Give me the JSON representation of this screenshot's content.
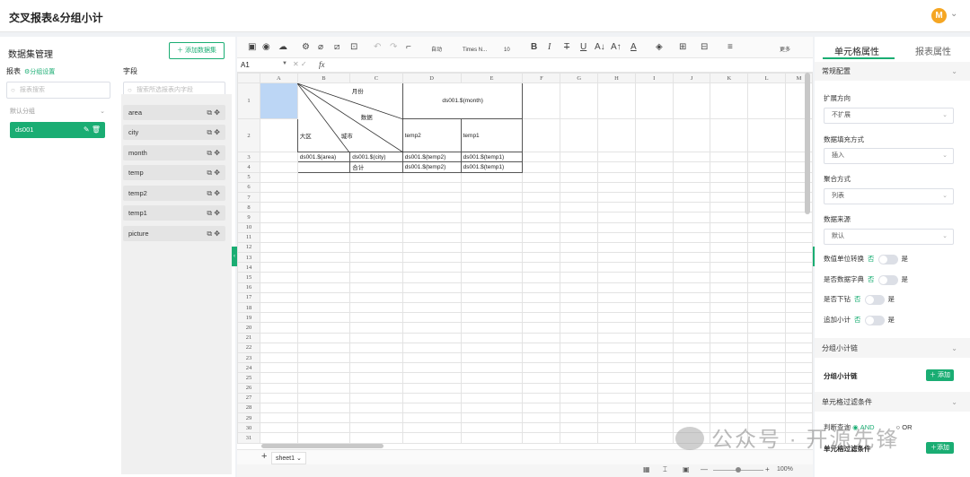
{
  "app": {
    "title": "交叉报表&分组小计",
    "avatar_letter": "M"
  },
  "left": {
    "panel_title": "数据集管理",
    "add_dataset_label": "＋ 添加数据集",
    "report_label": "报表",
    "group_settings_label": "⚙分组设置",
    "fields_label": "字段",
    "report_search_placeholder": "报表搜索",
    "field_search_placeholder": "搜索所选报表内字段",
    "default_group": "默认分组",
    "dataset_name": "ds001",
    "fields": [
      "area",
      "city",
      "month",
      "temp",
      "temp2",
      "temp1",
      "picture"
    ]
  },
  "toolbar": {
    "font_name": "Times N...",
    "font_size": "10",
    "auto_label": "自动",
    "more_label": "更多"
  },
  "formula_bar": {
    "cell_ref": "A1",
    "fx": "fx"
  },
  "sheet": {
    "columns": [
      "A",
      "B",
      "C",
      "D",
      "E",
      "F",
      "G",
      "H",
      "I",
      "J",
      "K",
      "L",
      "M"
    ],
    "header_month": "月份",
    "header_data": "数据",
    "header_region": "大区",
    "header_city": "城市",
    "month_expr": "ds001.$(month)",
    "temp2_header": "temp2",
    "temp1_header": "temp1",
    "row3": [
      "ds001.$(area)",
      "ds001.$(city)",
      "ds001.$(temp2)",
      "ds001.$(temp1)"
    ],
    "row4_label": "合计",
    "row4": [
      "ds001.$(temp2)",
      "ds001.$(temp1)"
    ],
    "tab_name": "sheet1",
    "zoom": "100%"
  },
  "right": {
    "tab_cell": "单元格属性",
    "tab_report": "报表属性",
    "sec_common": "常规配置",
    "expand_label": "扩展方向",
    "expand_value": "不扩展",
    "fill_label": "数据填充方式",
    "fill_value": "插入",
    "agg_label": "聚合方式",
    "agg_value": "列表",
    "source_label": "数据来源",
    "source_value": "默认",
    "unit_conv_label": "数值单位转换",
    "dict_label": "是否数据字典",
    "drill_label": "是否下钻",
    "subtotal_label": "追加小计",
    "no": "否",
    "yes": "是",
    "sec_group_subtotal": "分组小计链",
    "group_subtotal_title": "分组小计链",
    "add_label": "＋ 添加",
    "sec_filter": "单元格过滤条件",
    "judge_label": "判断查询",
    "and_label": "AND",
    "or_label": "OR",
    "filter_title": "单元格过滤条件",
    "add_label2": "＋添加"
  },
  "watermark": {
    "text": "公众号 · 开源先锋"
  }
}
